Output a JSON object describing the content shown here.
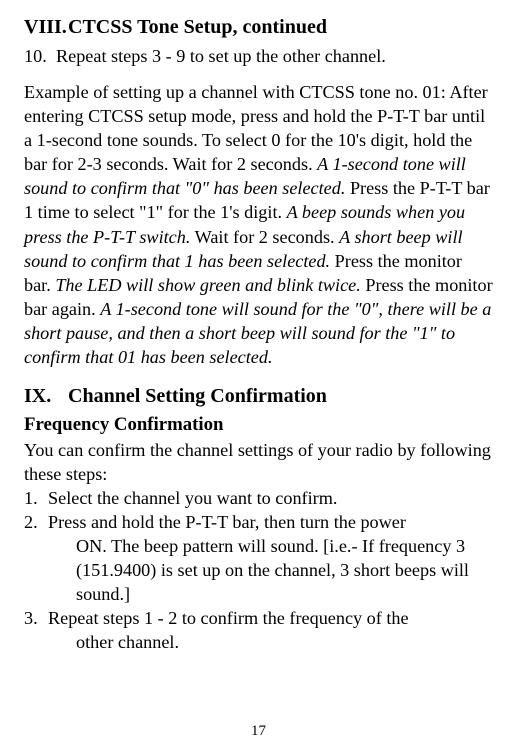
{
  "section8": {
    "num": "VIII.",
    "title": "CTCSS Tone Setup, continued",
    "step10_num": "10.",
    "step10_text": "Repeat steps 3 - 9 to set up the other channel.",
    "example": {
      "p1": "Example of setting up a channel with CTCSS tone no. 01: After entering CTCSS setup mode, press and hold the P-T-T bar until a 1-second tone sounds. To select 0 for the 10's digit, hold the bar for 2-3 seconds. Wait for 2 seconds. ",
      "i1": "A 1-second tone will sound to confirm that \"0\" has been selected.",
      "p2": " Press the P-T-T bar 1 time to select \"1\" for the 1's digit. ",
      "i2": "A beep sounds when you press the P-T-T switch.",
      "p3": " Wait for 2 seconds. ",
      "i3": "A short beep will sound to confirm that 1 has been selected.",
      "p4": " Press the monitor bar. ",
      "i4": "The LED will show green and blink twice.",
      "p5": " Press the monitor bar again. ",
      "i5": "A 1-second tone will sound for the \"0\", there will be a short pause, and then a short beep will sound for the \"1\" to confirm that 01 has been selected."
    }
  },
  "section9": {
    "num": "IX.",
    "title": "Channel Setting Confirmation",
    "subheading": "Frequency Confirmation",
    "intro": "You can confirm the channel settings of your radio by following these steps:",
    "items": [
      {
        "num": "1.",
        "body": "Select the channel you want to confirm."
      },
      {
        "num": "2.",
        "body": "Press and hold the P-T-T bar, then turn the power",
        "cont": "ON. The beep pattern will sound. [i.e.- If frequency 3 (151.9400) is set up on the channel, 3 short beeps will sound.]"
      },
      {
        "num": "3.",
        "body": "Repeat steps 1 - 2 to confirm the frequency of the",
        "cont": "other channel."
      }
    ]
  },
  "page_number": "17"
}
